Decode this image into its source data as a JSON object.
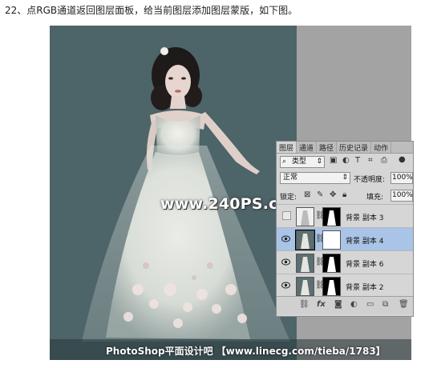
{
  "caption": "22、点RGB通道返回图层面板，给当前图层添加图层蒙版，如下图。",
  "watermark": "www.240PS.com",
  "credit": "PhotoShop平面设计吧 【www.linecg.com/tieba/1783】",
  "layers_panel": {
    "tabs": [
      "图层",
      "通道",
      "路径",
      "历史记录",
      "动作"
    ],
    "active_tab": "图层",
    "kind_filter": "类型",
    "blend_mode": "正常",
    "opacity_label": "不透明度:",
    "opacity_value": "100%",
    "lock_label": "锁定:",
    "fill_label": "填充:",
    "fill_value": "100%",
    "layers": [
      {
        "name": "背景 副本 3",
        "visible": false,
        "selected": false
      },
      {
        "name": "背景 副本 4",
        "visible": true,
        "selected": true
      },
      {
        "name": "背景 副本 6",
        "visible": true,
        "selected": false
      },
      {
        "name": "背景 副本 2",
        "visible": true,
        "selected": false
      }
    ],
    "footer_icons": [
      "link-icon",
      "fx-icon",
      "mask-icon",
      "adjustment-icon",
      "folder-icon",
      "new-layer-icon",
      "trash-icon"
    ]
  },
  "colors": {
    "canvas_bg": "#4d6468",
    "panel_bg": "#d6d6d6",
    "selected_row": "#a9c4e6"
  }
}
